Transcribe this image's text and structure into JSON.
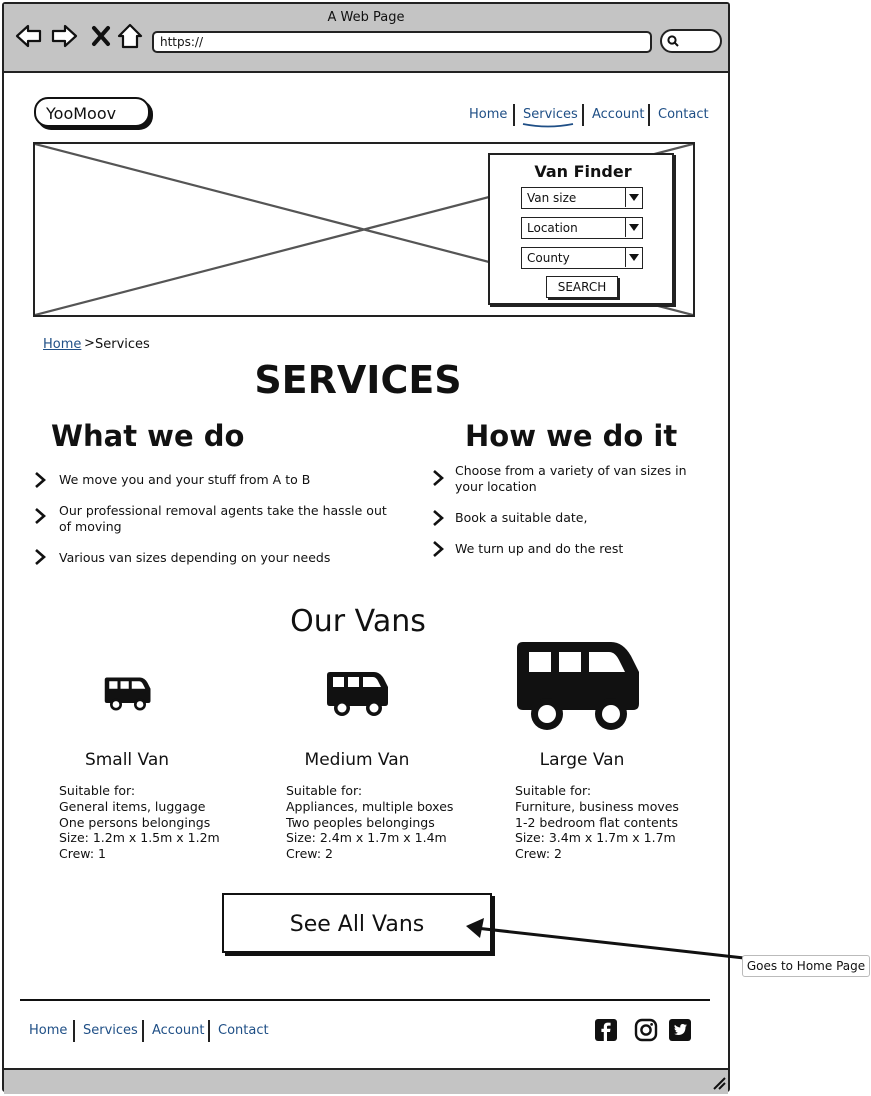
{
  "browser": {
    "title": "A Web Page",
    "url": "https://"
  },
  "site": {
    "logo": "YooMoov",
    "nav": [
      "Home",
      "Services",
      "Account",
      "Contact"
    ],
    "active_nav": "Services"
  },
  "van_finder": {
    "title": "Van Finder",
    "selects": [
      "Van size",
      "Location",
      "County"
    ],
    "search_label": "SEARCH"
  },
  "breadcrumb": {
    "home": "Home",
    "separator": ">",
    "current": "Services"
  },
  "page_title": "SERVICES",
  "what_we_do": {
    "heading": "What we do",
    "items": [
      "We move you and your stuff from A to B",
      "Our professional removal agents take the hassle out of moving",
      "Various van sizes depending on your needs"
    ]
  },
  "how_we_do_it": {
    "heading": "How we do it",
    "items": [
      "Choose from a variety of van sizes in your location",
      "Book a suitable date,",
      "We turn up and do the rest"
    ]
  },
  "our_vans": {
    "heading": "Our Vans",
    "vans": [
      {
        "name": "Small Van",
        "icon": "van-icon",
        "desc": "Suitable for:\nGeneral items, luggage\nOne persons belongings\nSize: 1.2m x 1.5m x 1.2m\nCrew: 1"
      },
      {
        "name": "Medium Van",
        "icon": "van-icon",
        "desc": "Suitable for:\nAppliances, multiple boxes\nTwo peoples belongings\nSize: 2.4m x 1.7m x 1.4m\nCrew: 2"
      },
      {
        "name": "Large Van",
        "icon": "van-icon",
        "desc": "Suitable for:\nFurniture, business moves\n1-2 bedroom flat contents\nSize: 3.4m x 1.7m x 1.7m\nCrew: 2"
      }
    ],
    "button": "See All Vans"
  },
  "annotation": "Goes to Home Page",
  "footer": {
    "nav": [
      "Home",
      "Services",
      "Account",
      "Contact"
    ],
    "social_icons": [
      "facebook-icon",
      "instagram-icon",
      "twitter-icon"
    ]
  },
  "colors": {
    "link": "#1f4f86",
    "chrome": "#c4c4c4",
    "ink": "#111111"
  }
}
